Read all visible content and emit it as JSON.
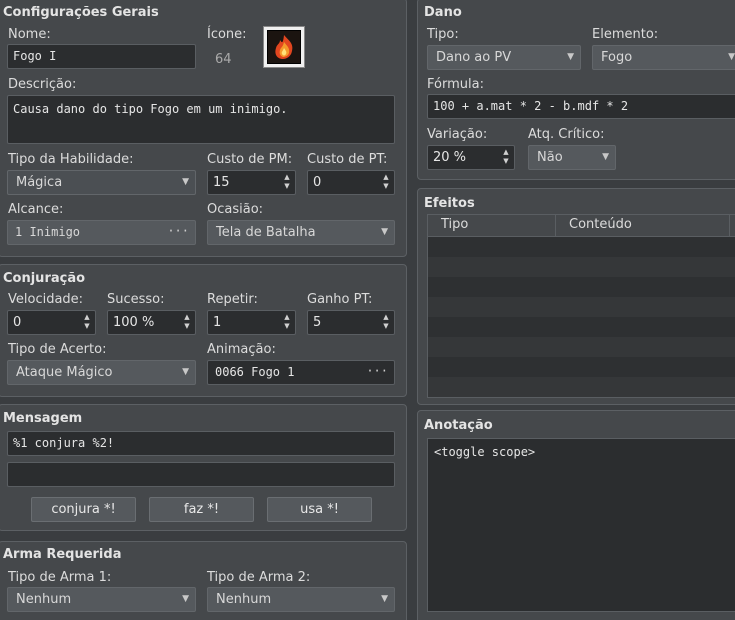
{
  "general": {
    "title": "Configurações Gerais",
    "name_label": "Nome:",
    "name_value": "Fogo I",
    "icon_label": "Ícone:",
    "icon_index": "64",
    "description_label": "Descrição:",
    "description_value": "Causa dano do tipo Fogo em um inimigo.",
    "skill_type_label": "Tipo da Habilidade:",
    "skill_type_value": "Mágica",
    "mp_cost_label": "Custo de PM:",
    "mp_cost_value": "15",
    "tp_cost_label": "Custo de PT:",
    "tp_cost_value": "0",
    "scope_label": "Alcance:",
    "scope_value": "1 Inimigo",
    "occasion_label": "Ocasião:",
    "occasion_value": "Tela de Batalha"
  },
  "invocation": {
    "title": "Conjuração",
    "speed_label": "Velocidade:",
    "speed_value": "0",
    "success_label": "Sucesso:",
    "success_value": "100 %",
    "repeat_label": "Repetir:",
    "repeat_value": "1",
    "tp_gain_label": "Ganho PT:",
    "tp_gain_value": "5",
    "hit_type_label": "Tipo de Acerto:",
    "hit_type_value": "Ataque Mágico",
    "animation_label": "Animação:",
    "animation_value": "0066 Fogo 1"
  },
  "message": {
    "title": "Mensagem",
    "line1": "%1 conjura %2!",
    "line2": "",
    "btn_cast": "conjura *!",
    "btn_do": "faz *!",
    "btn_use": "usa *!"
  },
  "weapon": {
    "title": "Arma Requerida",
    "type1_label": "Tipo de Arma 1:",
    "type1_value": "Nenhum",
    "type2_label": "Tipo de Arma 2:",
    "type2_value": "Nenhum"
  },
  "damage": {
    "title": "Dano",
    "type_label": "Tipo:",
    "type_value": "Dano ao PV",
    "element_label": "Elemento:",
    "element_value": "Fogo",
    "formula_label": "Fórmula:",
    "formula_value": "100 + a.mat * 2 - b.mdf * 2",
    "variance_label": "Variação:",
    "variance_value": "20 %",
    "critical_label": "Atq. Crítico:",
    "critical_value": "Não"
  },
  "effects": {
    "title": "Efeitos",
    "col_type": "Tipo",
    "col_content": "Conteúdo"
  },
  "note": {
    "title": "Anotação",
    "value": "<toggle scope>"
  },
  "icons": {
    "up_arrow": "▲",
    "down_arrow": "▼",
    "ellipsis": "···"
  }
}
